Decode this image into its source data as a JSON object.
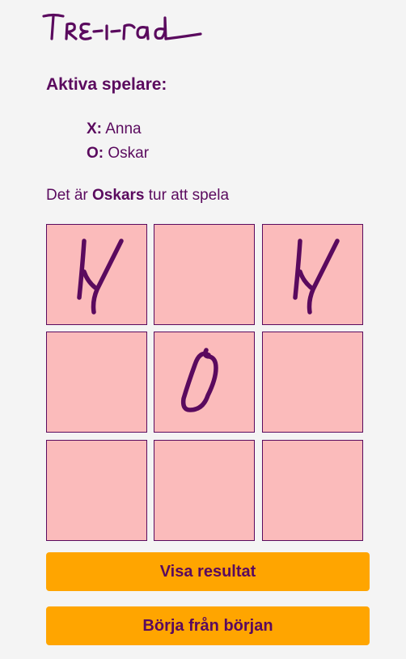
{
  "app": {
    "logo_text": "Tre-i-rad"
  },
  "players": {
    "heading": "Aktiva spelare:",
    "x": {
      "label": "X:",
      "name": "Anna"
    },
    "o": {
      "label": "O:",
      "name": "Oskar"
    }
  },
  "turn": {
    "prefix": "Det är ",
    "name": "Oskars",
    "suffix": " tur att spela"
  },
  "board": {
    "cells": [
      "X",
      "",
      "X",
      "",
      "O",
      "",
      "",
      "",
      ""
    ]
  },
  "buttons": {
    "results": "Visa resultat",
    "restart": "Börja från början"
  },
  "colors": {
    "background": "#f4f4f4",
    "text": "#5a0a5e",
    "cell": "#fbbbbb",
    "button": "#ffa500"
  }
}
